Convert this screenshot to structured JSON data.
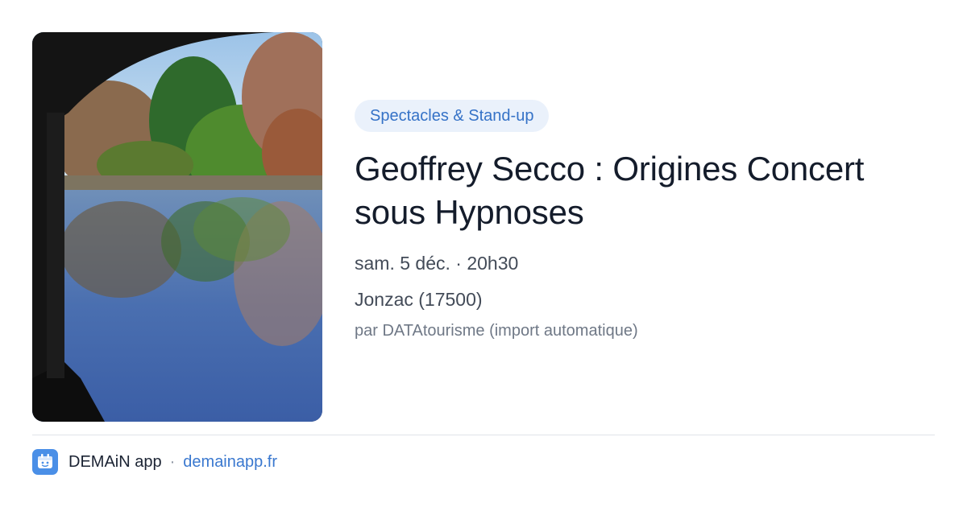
{
  "event": {
    "category": "Spectacles & Stand-up",
    "title": "Geoffrey Secco : Origines Concert sous Hypnoses",
    "datetime": "sam. 5 déc. · 20h30",
    "location": "Jonzac (17500)",
    "source": "par DATAtourisme (import automatique)"
  },
  "footer": {
    "app_name": "DEMAiN app",
    "separator": "·",
    "link_text": "demainapp.fr",
    "logo_icon": "demain-logo-icon"
  },
  "colors": {
    "accent": "#3a78cf",
    "chip_background": "#eaf1fb",
    "logo_background": "#4a8fe7"
  }
}
